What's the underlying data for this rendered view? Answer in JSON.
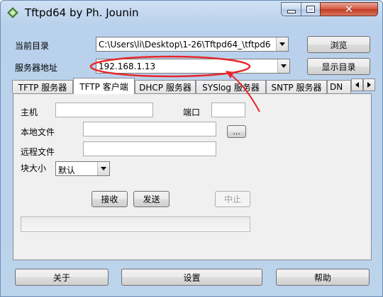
{
  "window": {
    "title": "Tftpd64 by Ph. Jounin",
    "icon": "tftpd-app-icon",
    "controls": [
      "minimize-icon",
      "maximize-icon",
      "close-icon"
    ]
  },
  "fields": {
    "current_dir_label": "当前目录",
    "current_dir_value": "C:\\Users\\li\\Desktop\\1-26\\Tftpd64_\\tftpd6",
    "browse_button": "浏览",
    "server_addr_label": "服务器地址",
    "server_addr_value": "192.168.1.13",
    "show_dir_button": "显示目录"
  },
  "tabs": [
    {
      "label": "TFTP 服务器",
      "active": false
    },
    {
      "label": "TFTP 客户端",
      "active": true
    },
    {
      "label": "DHCP 服务器",
      "active": false
    },
    {
      "label": "SYSlog 服务器",
      "active": false
    },
    {
      "label": "SNTP 服务器",
      "active": false
    },
    {
      "label": "DN",
      "active": false
    }
  ],
  "client_panel": {
    "host_label": "主机",
    "host_value": "",
    "port_label": "端口",
    "port_value": "",
    "local_file_label": "本地文件",
    "local_file_value": "",
    "browse_dots": "...",
    "remote_file_label": "远程文件",
    "remote_file_value": "",
    "block_size_label": "块大小",
    "block_size_value": "默认",
    "get_button": "接收",
    "put_button": "发送",
    "break_button": "中止",
    "progress": 0
  },
  "bottom_bar": {
    "about_button": "关于",
    "settings_button": "设置",
    "help_button": "帮助"
  },
  "colors": {
    "annotation": "#e8262a",
    "title_bar": "#b9d1ec",
    "close_button": "#c23a22",
    "progress_fill": "#06b025"
  }
}
